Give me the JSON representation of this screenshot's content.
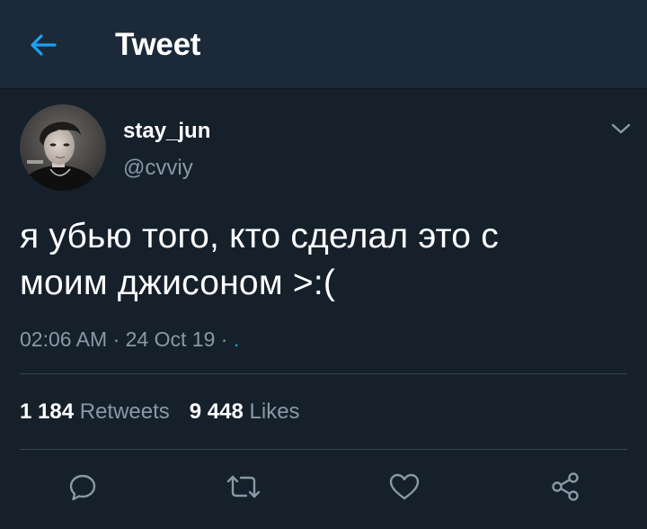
{
  "header": {
    "title": "Tweet",
    "back_icon": "arrow-left-icon"
  },
  "tweet": {
    "author": {
      "display_name": "stay_jun",
      "handle": "@cvviy"
    },
    "text_line1": "я убью того, кто сделал это с",
    "text_line2": "моим джисоном >:(",
    "time": "02:06 AM",
    "date": "24 Oct 19",
    "separator": "·",
    "source": "."
  },
  "stats": {
    "retweets_count": "1 184",
    "retweets_label": "Retweets",
    "likes_count": "9 448",
    "likes_label": "Likes"
  },
  "actions": [
    "reply-icon",
    "retweet-icon",
    "like-icon",
    "share-icon"
  ],
  "colors": {
    "background": "#15202b",
    "header_background": "#1c2938",
    "accent": "#1da1f2",
    "secondary_text": "#8899a6",
    "divider": "#38444d"
  }
}
